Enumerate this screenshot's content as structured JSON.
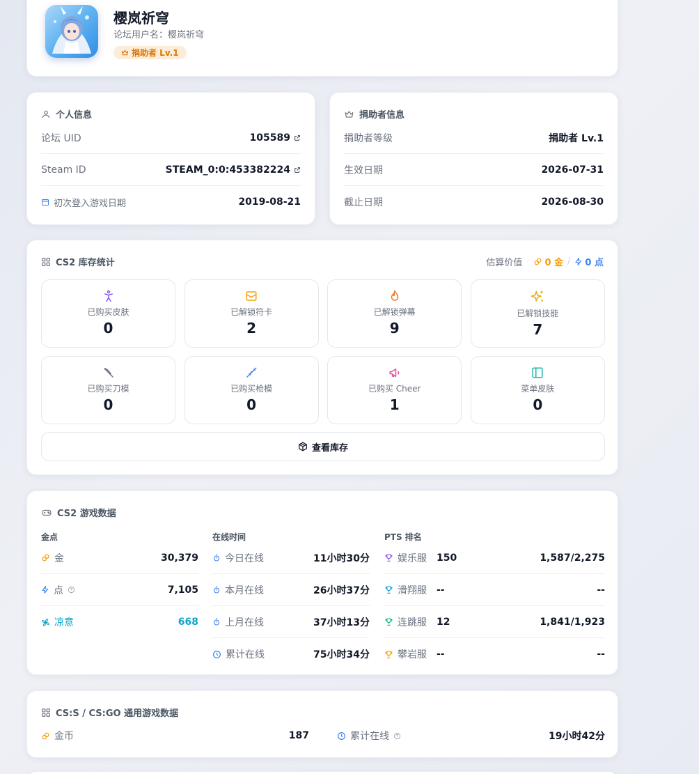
{
  "profile": {
    "name": "樱岚祈穹",
    "forum_username_label": "论坛用户名：",
    "forum_username": "樱岚祈穹",
    "badge": "捐助者 Lv.1"
  },
  "personal": {
    "title": "个人信息",
    "uid_label": "论坛 UID",
    "uid": "105589",
    "steam_label": "Steam ID",
    "steam_id": "STEAM_0:0:453382224",
    "first_login_label": "初次登入游戏日期",
    "first_login": "2019-08-21"
  },
  "donor": {
    "title": "捐助者信息",
    "level_label": "捐助者等级",
    "level": "捐助者 Lv.1",
    "start_label": "生效日期",
    "start": "2026-07-31",
    "end_label": "截止日期",
    "end": "2026-08-30"
  },
  "inventory": {
    "title": "CS2 库存统计",
    "estimate_label": "估算价值",
    "estimate_gold": "0 金",
    "estimate_sep": "/",
    "estimate_points": "0 点",
    "tiles": [
      {
        "label": "已购买皮肤",
        "value": "0"
      },
      {
        "label": "已解锁符卡",
        "value": "2"
      },
      {
        "label": "已解锁弹幕",
        "value": "9"
      },
      {
        "label": "已解锁技能",
        "value": "7"
      },
      {
        "label": "已购买刀模",
        "value": "0"
      },
      {
        "label": "已购买枪模",
        "value": "0"
      },
      {
        "label": "已购买 Cheer",
        "value": "1"
      },
      {
        "label": "菜单皮肤",
        "value": "0"
      }
    ],
    "view_button": "查看库存"
  },
  "game": {
    "title": "CS2 游戏数据",
    "currency_header": "金点",
    "currency": [
      {
        "label": "金",
        "value": "30,379"
      },
      {
        "label": "点",
        "value": "7,105"
      },
      {
        "label": "凉意",
        "value": "668"
      }
    ],
    "online_header": "在线时间",
    "online": [
      {
        "label": "今日在线",
        "value": "11小时30分"
      },
      {
        "label": "本月在线",
        "value": "26小时37分"
      },
      {
        "label": "上月在线",
        "value": "37小时13分"
      },
      {
        "label": "累计在线",
        "value": "75小时34分"
      }
    ],
    "rank_header": "PTS 排名",
    "ranks": [
      {
        "label": "娱乐服",
        "pts": "150",
        "rank": "1,587/2,275"
      },
      {
        "label": "滑翔服",
        "pts": "--",
        "rank": "--"
      },
      {
        "label": "连跳服",
        "pts": "12",
        "rank": "1,841/1,923"
      },
      {
        "label": "攀岩服",
        "pts": "--",
        "rank": "--"
      }
    ]
  },
  "csgo": {
    "title": "CS:S / CS:GO 通用游戏数据",
    "coins_label": "金币",
    "coins": "187",
    "online_label": "累计在线",
    "online": "19小时42分"
  },
  "colors": {
    "gold": "#f59e0b",
    "points": "#3b82f6",
    "cool": "#0ea5c9",
    "badge_bg": "#fdecd8"
  }
}
